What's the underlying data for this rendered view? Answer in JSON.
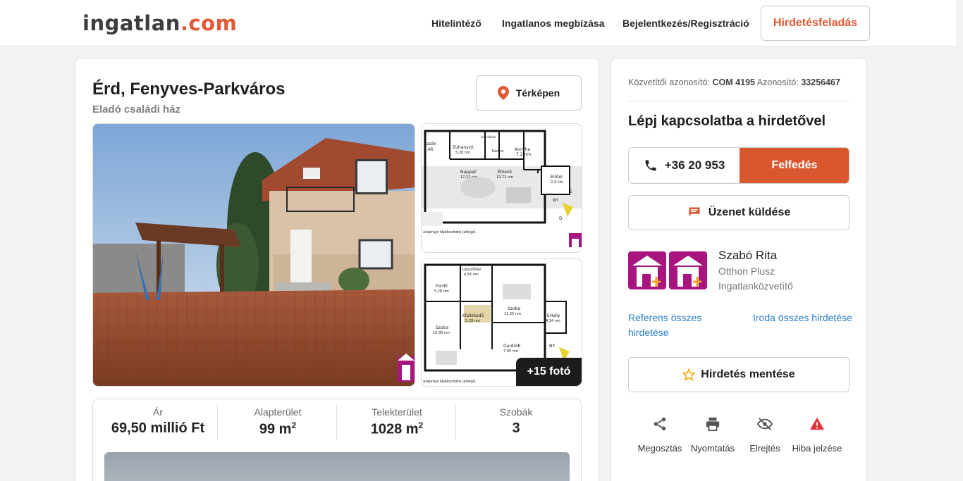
{
  "header": {
    "logo_main": "ingatlan",
    "logo_suffix": ".com",
    "nav": [
      "Hitelintéző",
      "Ingatlanos megbízása",
      "Bejelentkezés/Regisztráció"
    ],
    "post_ad": "Hirdetésfeladás"
  },
  "listing": {
    "title": "Érd, Fenyves-Parkváros",
    "subtitle": "Eladó családi ház",
    "map_button": "Térképen",
    "more_photos": "+15 fotó",
    "stats": [
      {
        "label": "Ár",
        "value": "69,50 millió Ft"
      },
      {
        "label": "Alapterület",
        "value": "99 m",
        "sup": "2"
      },
      {
        "label": "Telekterület",
        "value": "1028 m",
        "sup": "2"
      },
      {
        "label": "Szobák",
        "value": "3"
      }
    ],
    "floorplan1": {
      "rooms": [
        "Kazán",
        "4,46",
        "Zuhanyzó",
        "5,28 nm",
        "Kamra",
        "Konyha",
        "7,2 nm",
        "Nappali",
        "17,22 nm",
        "Étkező",
        "12,71 nm",
        "Előtér",
        "2,4 nm",
        "Lépcsőház",
        "NY",
        "É",
        "D"
      ],
      "note": "alaprajz tájékoztató jellegű."
    },
    "floorplan2": {
      "rooms": [
        "Lépcsőház",
        "4,56 nm",
        "Fürdő",
        "5,28 nm",
        "Szoba",
        "11,55 nm",
        "Erkély",
        "4,34 nm",
        "Közlekedő",
        "5,28 nm",
        "Szoba",
        "10,36 nm",
        "Gardrób",
        "7,95 nm",
        "NY"
      ],
      "note": "alaprajz tájékoztató jellegű."
    }
  },
  "sidebar": {
    "broker_id_label": "Közvetítői azonosító:",
    "broker_id": "COM 4195",
    "ad_id_label": "Azonosító:",
    "ad_id": "33256467",
    "contact_title": "Lépj kapcsolatba a hirdetővel",
    "phone": "+36 20 953",
    "reveal": "Felfedés",
    "message": "Üzenet küldése",
    "agent_name": "Szabó Rita",
    "agent_company": "Otthon Plusz",
    "agent_role": "Ingatlanközvetítő",
    "link_agent_ads": "Referens összes hirdetése",
    "link_office_ads": "Iroda összes hirdetése",
    "save": "Hirdetés mentése",
    "actions": [
      "Megosztás",
      "Nyomtatás",
      "Elrejtés",
      "Hiba jelzése"
    ]
  },
  "colors": {
    "brand": "#e05a35",
    "reveal": "#d9572f",
    "link": "#2a7ecb",
    "agent_logo": "#a8157e"
  }
}
